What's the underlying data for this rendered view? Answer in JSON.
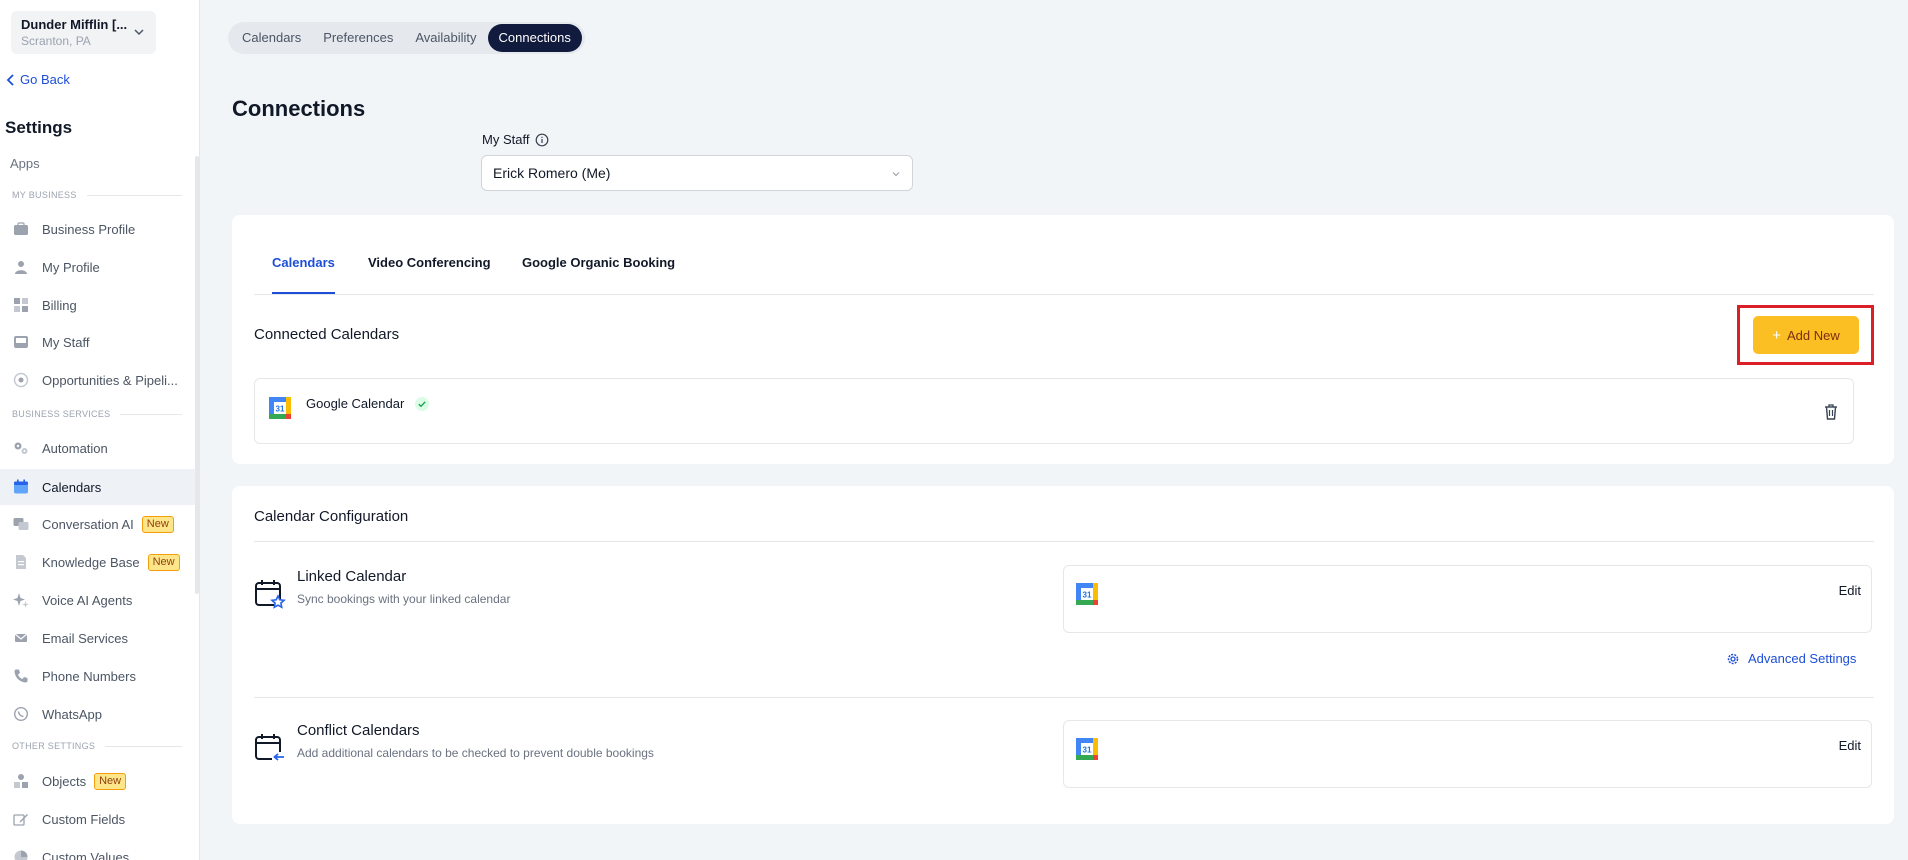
{
  "location": {
    "name": "Dunder Mifflin [...",
    "city": "Scranton, PA"
  },
  "sidebar": {
    "go_back": "Go Back",
    "title": "Settings",
    "apps": "Apps",
    "sections": {
      "my_business": "MY BUSINESS",
      "business_services": "BUSINESS SERVICES",
      "other_settings": "OTHER SETTINGS"
    },
    "items": [
      {
        "label": "Business Profile",
        "icon": "briefcase-icon"
      },
      {
        "label": "My Profile",
        "icon": "user-icon"
      },
      {
        "label": "Billing",
        "icon": "grid-icon"
      },
      {
        "label": "My Staff",
        "icon": "inbox-icon"
      },
      {
        "label": "Opportunities & Pipeli...",
        "icon": "target-icon"
      },
      {
        "label": "Automation",
        "icon": "gears-icon"
      },
      {
        "label": "Calendars",
        "icon": "calendar-icon",
        "active": true
      },
      {
        "label": "Conversation AI",
        "icon": "chat-icon",
        "badge": "New"
      },
      {
        "label": "Knowledge Base",
        "icon": "document-icon",
        "badge": "New"
      },
      {
        "label": "Voice AI Agents",
        "icon": "sparkle-icon"
      },
      {
        "label": "Email Services",
        "icon": "mail-icon"
      },
      {
        "label": "Phone Numbers",
        "icon": "phone-icon"
      },
      {
        "label": "WhatsApp",
        "icon": "whatsapp-icon"
      },
      {
        "label": "Objects",
        "icon": "shapes-icon",
        "badge": "New"
      },
      {
        "label": "Custom Fields",
        "icon": "edit-field-icon"
      },
      {
        "label": "Custom Values",
        "icon": "pie-icon"
      }
    ]
  },
  "top_tabs": [
    {
      "label": "Calendars"
    },
    {
      "label": "Preferences"
    },
    {
      "label": "Availability"
    },
    {
      "label": "Connections",
      "active": true
    }
  ],
  "page_title": "Connections",
  "staff": {
    "label": "My Staff",
    "selected": "Erick Romero (Me)"
  },
  "connections": {
    "tabs": [
      {
        "label": "Calendars",
        "active": true
      },
      {
        "label": "Video Conferencing"
      },
      {
        "label": "Google Organic Booking"
      }
    ],
    "connected_title": "Connected Calendars",
    "add_new": "Add New",
    "calendars": [
      {
        "name": "Google Calendar",
        "status": "connected"
      }
    ]
  },
  "config": {
    "title": "Calendar Configuration",
    "linked": {
      "title": "Linked Calendar",
      "desc": "Sync bookings with your linked calendar",
      "edit": "Edit"
    },
    "advanced": "Advanced Settings",
    "conflict": {
      "title": "Conflict Calendars",
      "desc": "Add additional calendars to be checked to prevent double bookings",
      "edit": "Edit"
    }
  },
  "colors": {
    "accent": "#1d4ed8",
    "add_button": "#fbbf24",
    "highlight": "#dc1f26",
    "active_tab": "#101b3d"
  }
}
